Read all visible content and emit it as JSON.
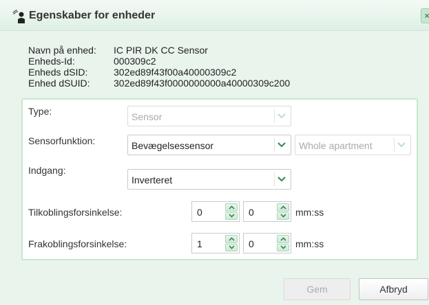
{
  "dialog": {
    "title": "Egenskaber for enheder",
    "close_label": "×"
  },
  "info": [
    {
      "key": "Navn på enhed:",
      "value": "IC PIR DK CC Sensor"
    },
    {
      "key": "Enheds-Id:",
      "value": "000309c2"
    },
    {
      "key": "Enheds dSID:",
      "value": "302ed89f43f00a40000309c2"
    },
    {
      "key": "Enhed dSUID:",
      "value": "302ed89f43f0000000000a40000309c200"
    }
  ],
  "form": {
    "type": {
      "label": "Type:",
      "value": "Sensor",
      "disabled": true
    },
    "sensor_function": {
      "label": "Sensorfunktion:",
      "value": "Bevægelsessensor",
      "scope_value": "Whole apartment"
    },
    "input": {
      "label": "Indgang:",
      "value": "Inverteret"
    },
    "on_delay": {
      "label": "Tilkoblingsforsinkelse:",
      "minutes": "0",
      "seconds": "0",
      "unit": "mm:ss"
    },
    "off_delay": {
      "label": "Frakoblingsforsinkelse:",
      "minutes": "1",
      "seconds": "0",
      "unit": "mm:ss"
    }
  },
  "buttons": {
    "save": "Gem",
    "cancel": "Afbryd"
  },
  "colors": {
    "accent": "#3e8a59",
    "background": "#e9f4ec",
    "panel_border": "#c7e6cf"
  }
}
